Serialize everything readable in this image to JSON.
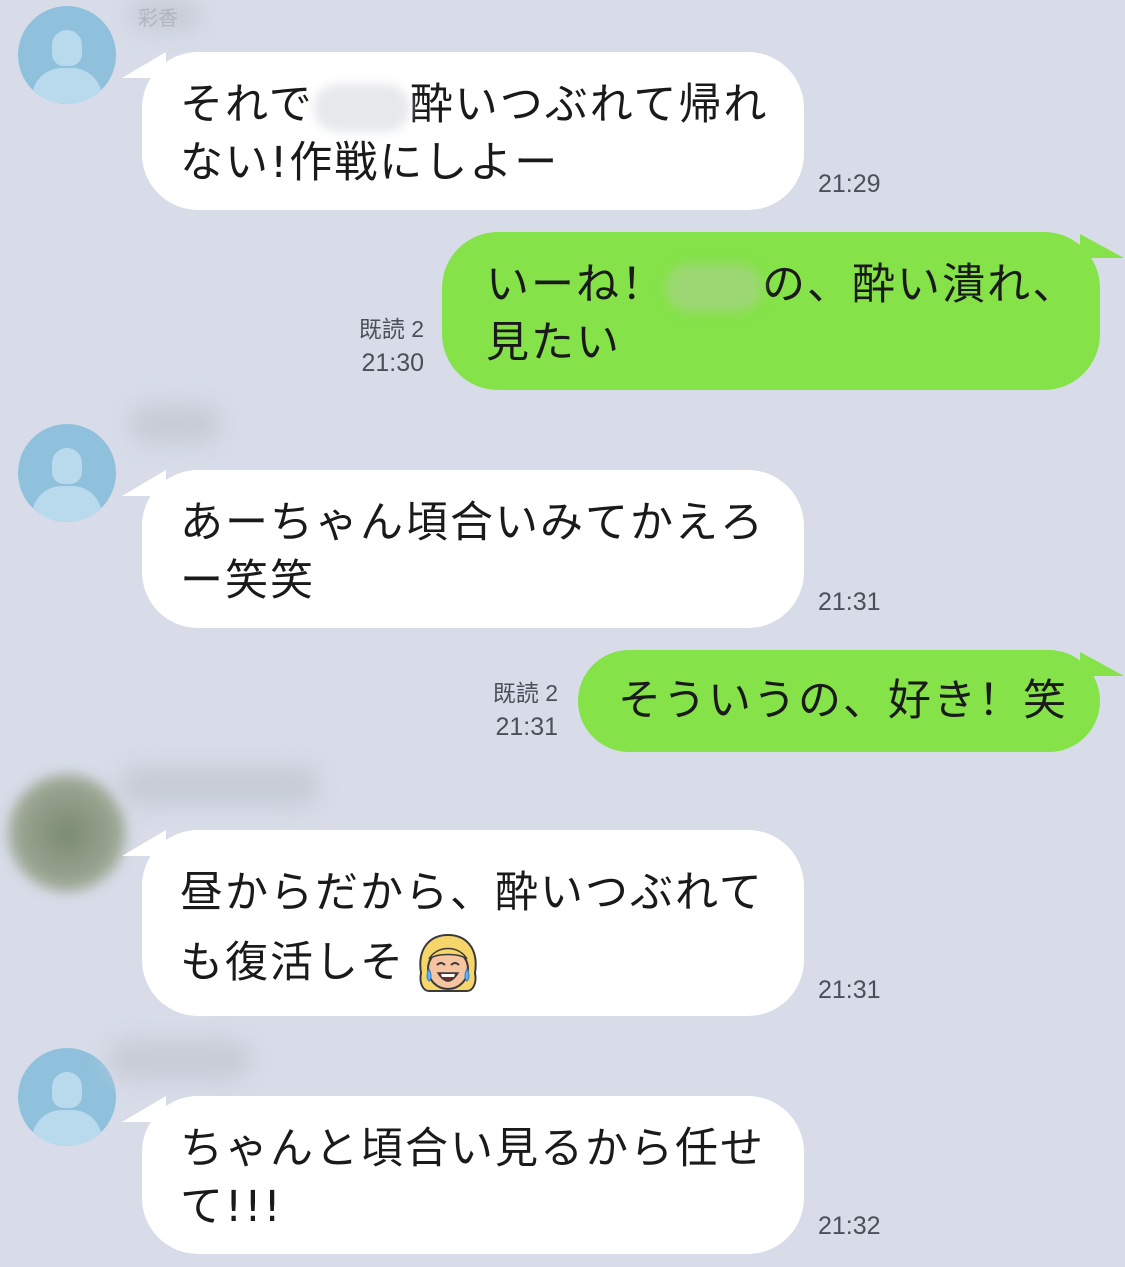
{
  "messages": [
    {
      "side": "in",
      "sender": "彩香",
      "lines": [
        "それで",
        "酔いつぶれて帰れ",
        "ない!作戦にしよー"
      ],
      "time": "21:29"
    },
    {
      "side": "out",
      "lines": [
        "いーね！",
        "の、酔い潰れ、",
        "見たい"
      ],
      "read": "既読 2",
      "time": "21:30"
    },
    {
      "side": "in",
      "lines": [
        "あーちゃん頃合いみてかえろ",
        "ー笑笑"
      ],
      "time": "21:31"
    },
    {
      "side": "out",
      "lines": [
        "そういうの、好き！笑"
      ],
      "read": "既読 2",
      "time": "21:31"
    },
    {
      "side": "in",
      "lines": [
        "昼からだから、酔いつぶれて",
        "も復活しそ"
      ],
      "emoji": "face-with-tears-of-joy-blonde",
      "time": "21:31"
    },
    {
      "side": "in",
      "lines": [
        "ちゃんと頃合い見るから任せ",
        "て!!!"
      ],
      "time": "21:32"
    }
  ],
  "colors": {
    "background": "#d7dce8",
    "incoming_bubble": "#ffffff",
    "outgoing_bubble": "#85e249",
    "avatar": "#8fc1dd"
  }
}
